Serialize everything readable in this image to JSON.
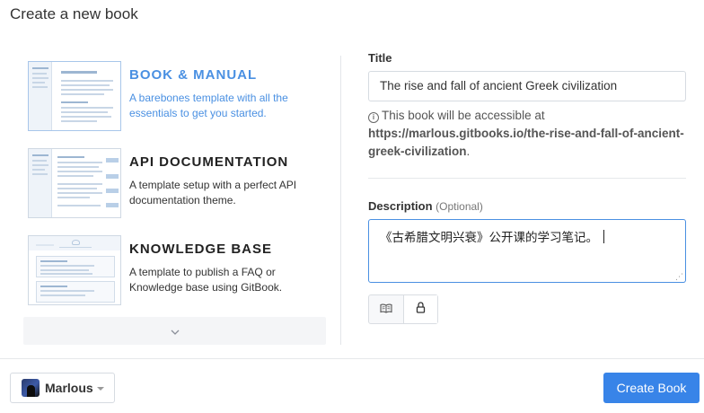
{
  "header": {
    "title": "Create a new book"
  },
  "templates": [
    {
      "name": "BOOK & MANUAL",
      "description": "A barebones template with all the essentials to get you started.",
      "selected": true
    },
    {
      "name": "API DOCUMENTATION",
      "description": "A template setup with a perfect API documentation theme.",
      "selected": false
    },
    {
      "name": "KNOWLEDGE BASE",
      "description": "A template to publish a FAQ or Knowledge base using GitBook.",
      "selected": false
    }
  ],
  "more": {
    "icon": "chevron-down-icon",
    "glyph": "⌄"
  },
  "form": {
    "title_label": "Title",
    "title_value": "The rise and fall of ancient Greek civilization",
    "info_icon": "i",
    "info_text": "This book will be accessible at",
    "info_url": "https://marlous.gitbooks.io/the-rise-and-fall-of-ancient-greek-civilization",
    "info_end": ".",
    "description_label": "Description",
    "description_optional": "(Optional)",
    "description_value": "《古希腊文明兴衰》公开课的学习笔记。",
    "resize_glyph": "⋰"
  },
  "footer": {
    "account_name": "Marlous",
    "create_label": "Create Book"
  },
  "colors": {
    "accent": "#4a90e2",
    "button": "#3884e8"
  }
}
